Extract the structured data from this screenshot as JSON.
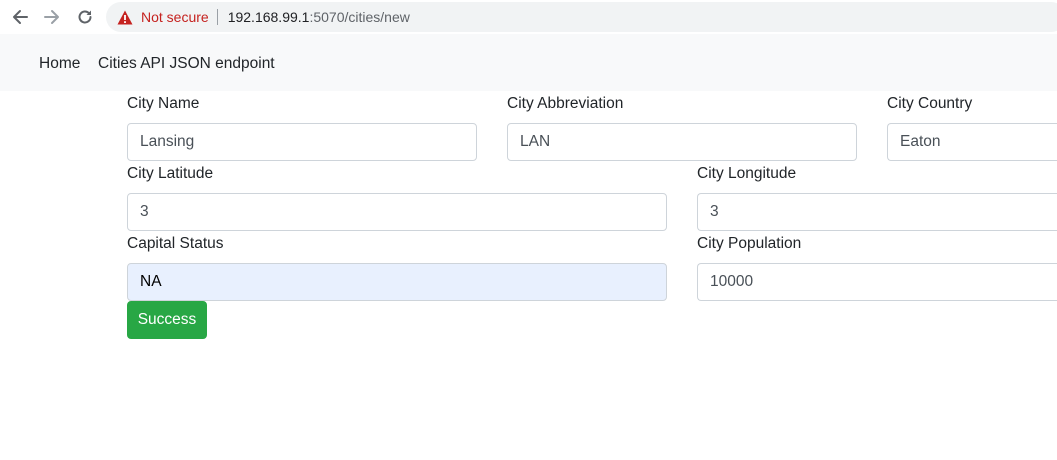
{
  "browser": {
    "security_label": "Not secure",
    "url_host": "192.168.99.1",
    "url_rest": ":5070/cities/new",
    "icons": [
      "back-arrow-icon",
      "forward-arrow-icon",
      "reload-icon",
      "warning-icon"
    ]
  },
  "navbar": {
    "home_label": "Home",
    "api_label": "Cities API JSON endpoint"
  },
  "form": {
    "city_name": {
      "label": "City Name",
      "value": "Lansing"
    },
    "city_abbreviation": {
      "label": "City Abbreviation",
      "value": "LAN"
    },
    "city_country": {
      "label": "City Country",
      "value": "Eaton"
    },
    "city_latitude": {
      "label": "City Latitude",
      "value": "3"
    },
    "city_longitude": {
      "label": "City Longitude",
      "value": "3"
    },
    "capital_status": {
      "label": "Capital Status",
      "value": "NA"
    },
    "city_population": {
      "label": "City Population",
      "value": "10000"
    },
    "submit_label": "Success"
  },
  "colors": {
    "success": "#28a745",
    "not_secure": "#c5221f",
    "autofill_bg": "#e8f0fe",
    "navbar_bg": "#f8f9fa"
  }
}
